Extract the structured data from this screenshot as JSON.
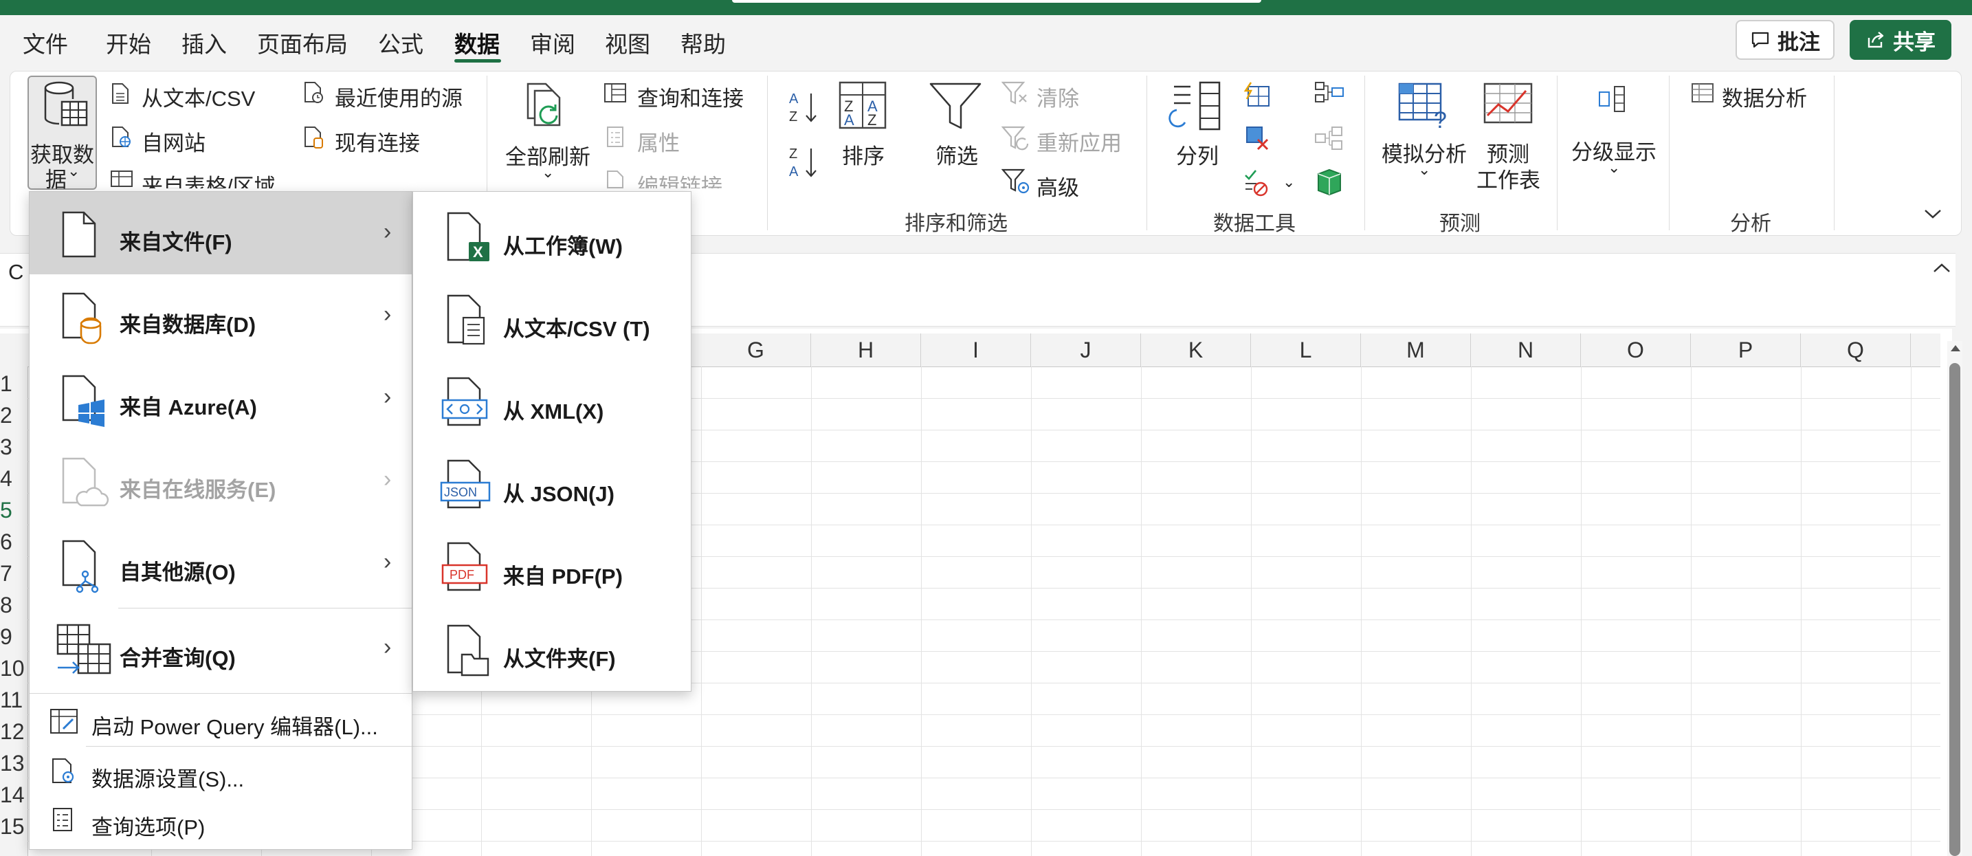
{
  "ribbon_tabs": {
    "file": "文件",
    "home": "开始",
    "insert": "插入",
    "page_layout": "页面布局",
    "formulas": "公式",
    "data": "数据",
    "review": "审阅",
    "view": "视图",
    "help": "帮助"
  },
  "header_buttons": {
    "comment": "批注",
    "share": "共享"
  },
  "get_transform": {
    "get_data_line1": "获取数",
    "get_data_line2": "据",
    "from_text_csv": "从文本/CSV",
    "from_web": "自网站",
    "from_table_range": "来自表格/区域",
    "recent_sources": "最近使用的源",
    "existing_connections": "现有连接"
  },
  "queries_connections": {
    "refresh_all": "全部刷新",
    "queries_and_connections": "查询和连接",
    "properties": "属性",
    "edit_links": "编辑链接"
  },
  "sort_filter": {
    "sort": "排序",
    "filter": "筛选",
    "clear": "清除",
    "reapply": "重新应用",
    "advanced": "高级",
    "group_label": "排序和筛选"
  },
  "data_tools": {
    "text_to_columns": "分列",
    "group_label": "数据工具"
  },
  "forecast": {
    "what_if": "模拟分析",
    "forecast_sheet_line1": "预测",
    "forecast_sheet_line2": "工作表",
    "group_label": "预测"
  },
  "outline": {
    "label": "分级显示"
  },
  "analysis": {
    "data_analysis": "数据分析",
    "group_label": "分析"
  },
  "name_box_partial": "C",
  "columns": [
    "G",
    "H",
    "I",
    "J",
    "K",
    "L",
    "M",
    "N",
    "O",
    "P",
    "Q"
  ],
  "rows": [
    "1",
    "2",
    "3",
    "4",
    "5",
    "6",
    "7",
    "8",
    "9",
    "10",
    "11",
    "12",
    "13",
    "14",
    "15"
  ],
  "get_data_menu": {
    "from_file": "来自文件(F)",
    "from_database": "来自数据库(D)",
    "from_azure": "来自 Azure(A)",
    "from_online_services": "来自在线服务(E)",
    "from_other_sources": "自其他源(O)",
    "combine_queries": "合并查询(Q)",
    "launch_pq_editor": "启动 Power Query 编辑器(L)...",
    "data_source_settings": "数据源设置(S)...",
    "query_options": "查询选项(P)"
  },
  "from_file_submenu": {
    "from_workbook": "从工作簿(W)",
    "from_text_csv": "从文本/CSV (T)",
    "from_xml": "从 XML(X)",
    "from_json": "从 JSON(J)",
    "from_pdf": "来自 PDF(P)",
    "from_folder": "从文件夹(F)"
  },
  "icon_text": {
    "json": "JSON",
    "pdf": "PDF",
    "excel": "X"
  },
  "colors": {
    "accent": "#1f7145",
    "highlight": "#d4d4d4",
    "disabled": "#a3a3a3"
  }
}
